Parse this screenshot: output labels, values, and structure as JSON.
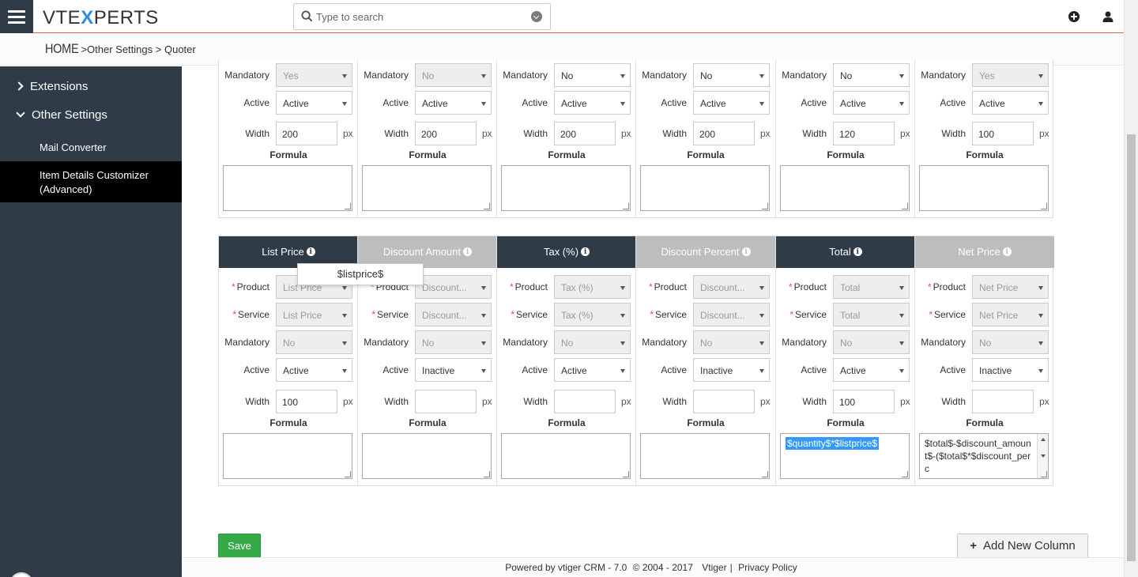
{
  "header": {
    "logo_prefix": "VTE",
    "logo_x": "X",
    "logo_suffix": "PERTS",
    "search_placeholder": "Type to search"
  },
  "breadcrumb": {
    "home": "HOME",
    "sep1": ">",
    "level1": "Other Settings",
    "sep2": ">",
    "level2": "Quoter"
  },
  "sidebar": {
    "extensions": "Extensions",
    "other_settings": "Other Settings",
    "mail_converter": "Mail Converter",
    "item_details_line1": "Item Details Customizer",
    "item_details_line2": "(Advanced)"
  },
  "labels": {
    "product": "Product",
    "service": "Service",
    "mandatory": "Mandatory",
    "active": "Active",
    "width": "Width",
    "px": "px",
    "formula": "Formula",
    "req": "*"
  },
  "top_columns": [
    {
      "mandatory": "Yes",
      "mandatory_disabled": true,
      "active": "Active",
      "width": "200",
      "formula": ""
    },
    {
      "mandatory": "No",
      "mandatory_disabled": true,
      "active": "Active",
      "width": "200",
      "formula": ""
    },
    {
      "mandatory": "No",
      "mandatory_disabled": false,
      "active": "Active",
      "width": "200",
      "formula": ""
    },
    {
      "mandatory": "No",
      "mandatory_disabled": false,
      "active": "Active",
      "width": "200",
      "formula": ""
    },
    {
      "mandatory": "No",
      "mandatory_disabled": false,
      "active": "Active",
      "width": "120",
      "formula": ""
    },
    {
      "mandatory": "Yes",
      "mandatory_disabled": true,
      "active": "Active",
      "width": "100",
      "formula": ""
    }
  ],
  "bottom_columns": [
    {
      "title": "List Price",
      "dark": true,
      "product": "List Price",
      "service": "List Price",
      "mandatory": "No",
      "active": "Active",
      "width": "100",
      "formula": ""
    },
    {
      "title": "Discount Amount",
      "dark": false,
      "product": "Discount...",
      "service": "Discount...",
      "mandatory": "No",
      "active": "Inactive",
      "width": "",
      "formula": ""
    },
    {
      "title": "Tax (%)",
      "dark": true,
      "product": "Tax (%)",
      "service": "Tax (%)",
      "mandatory": "No",
      "active": "Active",
      "width": "",
      "formula": ""
    },
    {
      "title": "Discount Percent",
      "dark": false,
      "product": "Discount...",
      "service": "Discount...",
      "mandatory": "No",
      "active": "Inactive",
      "width": "",
      "formula": ""
    },
    {
      "title": "Total",
      "dark": true,
      "product": "Total",
      "service": "Total",
      "mandatory": "No",
      "active": "Active",
      "width": "100",
      "formula": "$quantity$*$listprice$"
    },
    {
      "title": "Net Price",
      "dark": false,
      "product": "Net Price",
      "service": "Net Price",
      "mandatory": "No",
      "active": "Inactive",
      "width": "",
      "formula": "$total$-$discount_amount$-($total$*$discount_perc"
    }
  ],
  "tooltip": "$listprice$",
  "buttons": {
    "save": "Save",
    "add_column_plus": "+",
    "add_column": "Add New Column"
  },
  "footer": {
    "powered": "Powered by vtiger CRM - 7.0",
    "copyright": "© 2004 - 2017",
    "vtiger": "Vtiger",
    "bar": "|",
    "privacy": "Privacy Policy"
  },
  "colors": {
    "sidebar": "#2f3c48",
    "accent_line": "#e8663a",
    "save": "#35aa47",
    "logo_x": "#2d8fd9"
  }
}
